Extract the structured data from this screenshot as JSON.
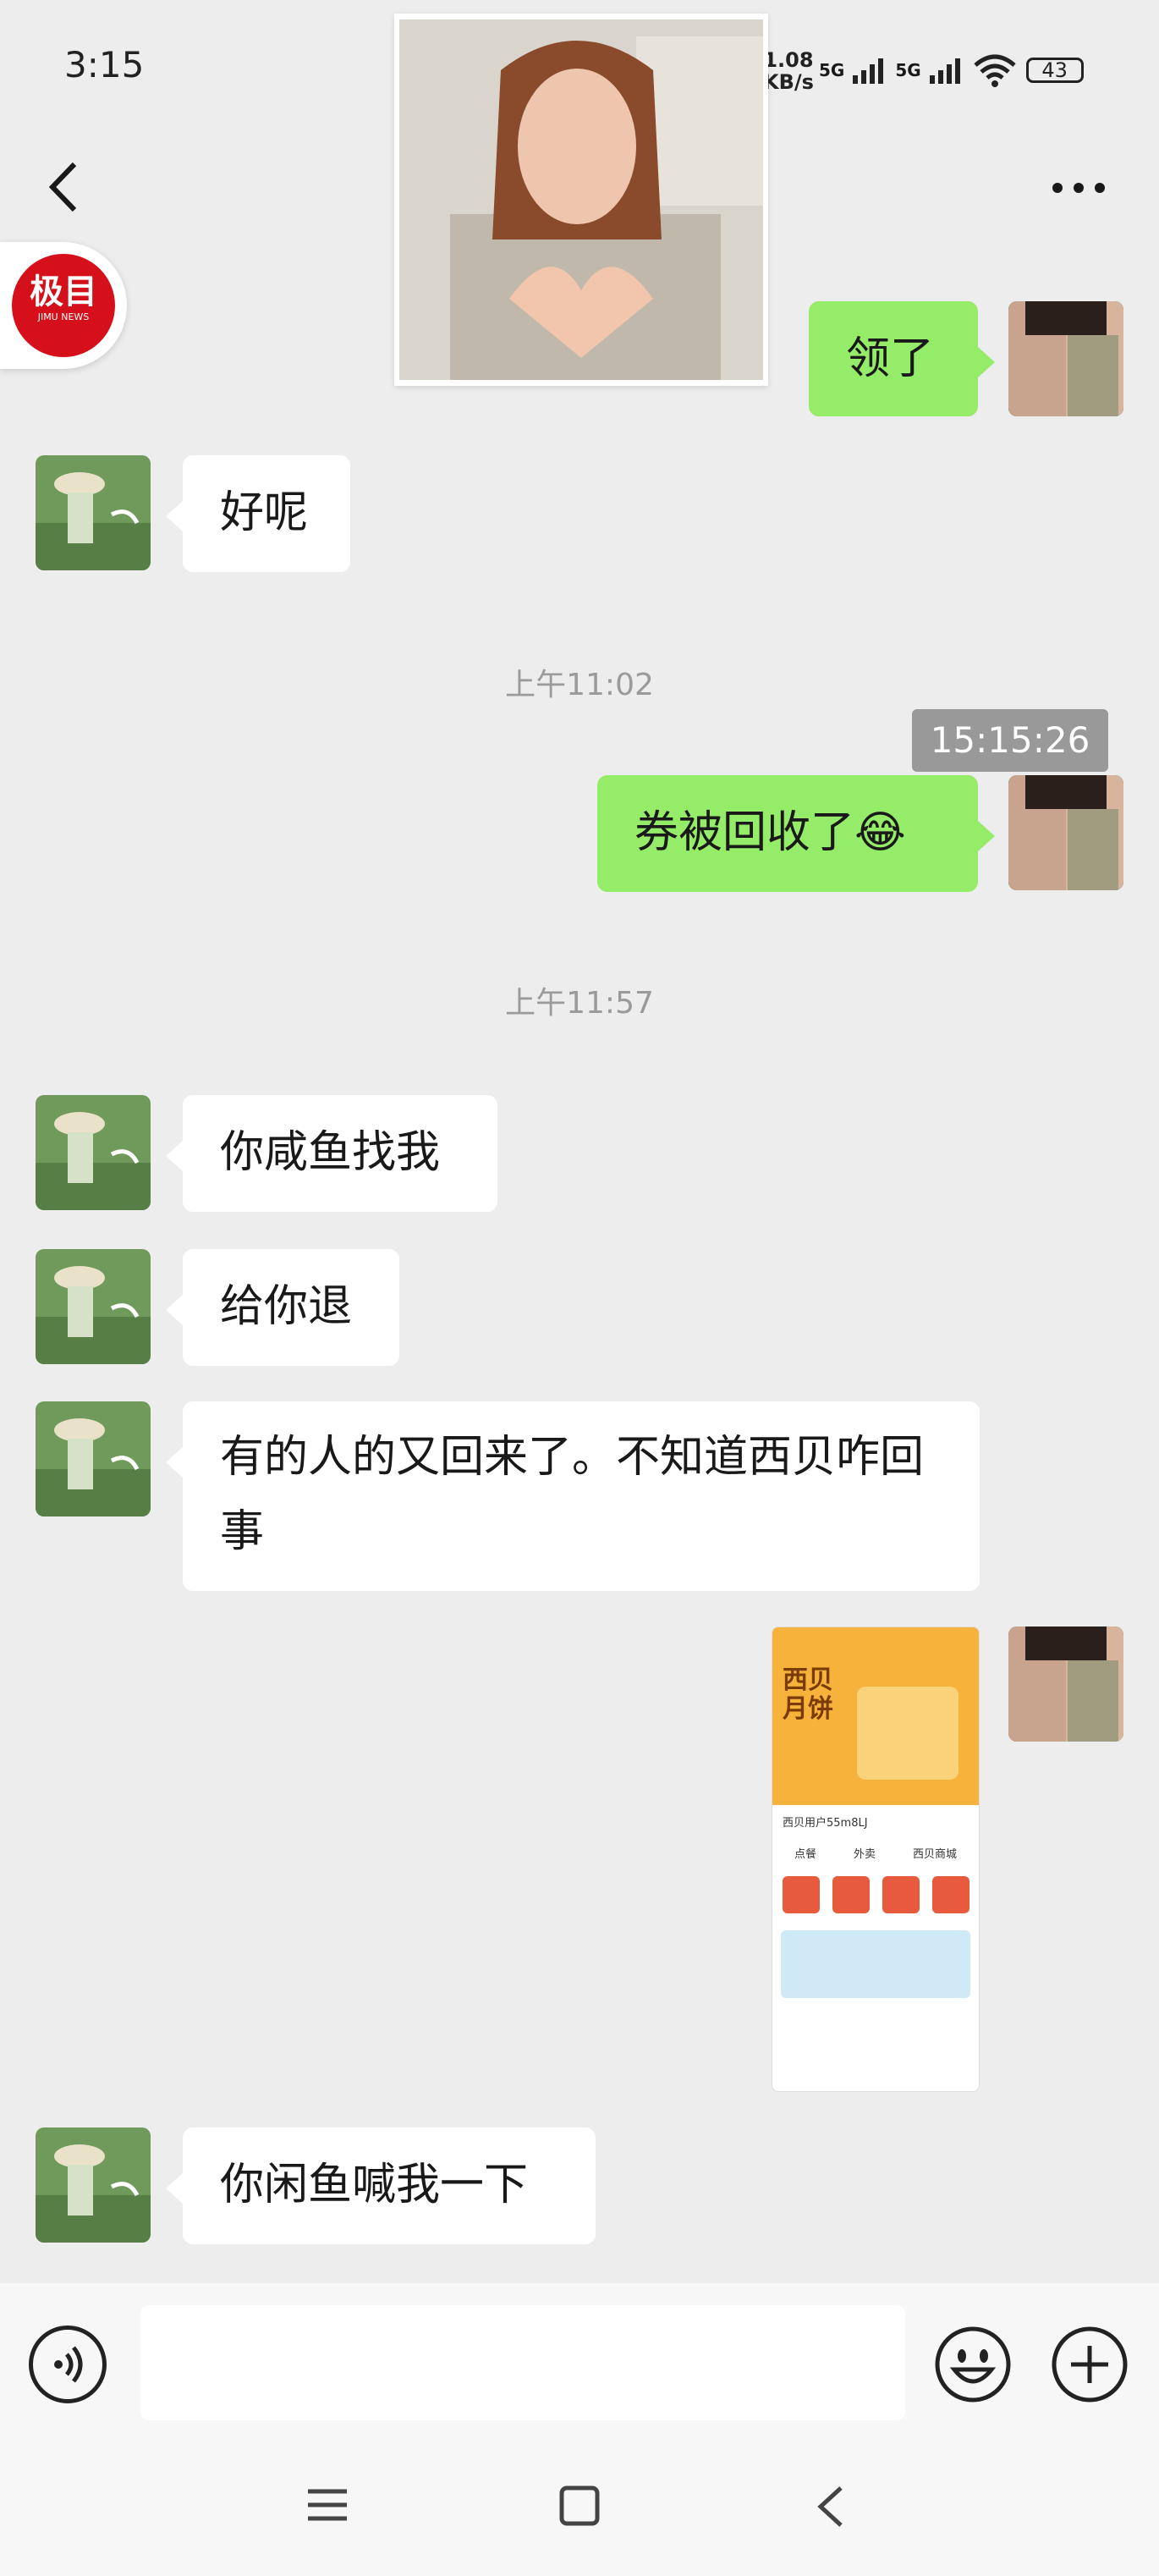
{
  "status_bar": {
    "time": "3:15",
    "net_speed_value": "1.08",
    "net_speed_unit": "KB/s",
    "sim1": "5G",
    "sim2": "5G",
    "battery": "43"
  },
  "badge": {
    "title": "极目",
    "subtitle": "JIMU NEWS"
  },
  "messages": {
    "m1": "领了",
    "m2": "好呢",
    "ts1": "上午11:02",
    "tooltip": "15:15:26",
    "m3": "券被回收了",
    "m3_emoji": "😂",
    "ts2": "上午11:57",
    "m4": "你咸鱼找我",
    "m5": "给你退",
    "m6": "有的人的又回来了。不知道西贝咋回事",
    "m7": "你闲鱼喊我一下"
  },
  "screenshot": {
    "card_title": "西贝月饼",
    "user": "西贝用户55m8LJ",
    "items": [
      "点餐",
      "外卖",
      "西贝商城"
    ]
  },
  "input": {
    "placeholder": ""
  },
  "colors": {
    "background": "#ededed",
    "sent_bubble": "#95ec69",
    "received_bubble": "#ffffff",
    "badge_red": "#d6101b"
  }
}
